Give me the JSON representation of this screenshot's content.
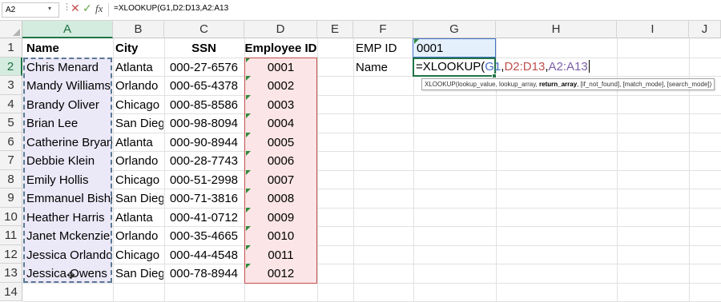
{
  "formula_bar": {
    "name_box": "A2",
    "dots": "⋮",
    "cancel_icon": "✕",
    "enter_icon": "✓",
    "fx_label": "fx",
    "formula": "=XLOOKUP(G1,D2:D13,A2:A13"
  },
  "columns": [
    "A",
    "B",
    "C",
    "D",
    "E",
    "F",
    "G",
    "H",
    "I",
    "J"
  ],
  "rows": [
    "1",
    "2",
    "3",
    "4",
    "5",
    "6",
    "7",
    "8",
    "9",
    "10",
    "11",
    "12",
    "13",
    "14"
  ],
  "table": {
    "headers": [
      "Name",
      "City",
      "SSN",
      "Employee ID"
    ],
    "data": [
      [
        "Chris Menard",
        "Atlanta",
        "000-27-6576",
        "0001"
      ],
      [
        "Mandy Williams",
        "Orlando",
        "000-65-4378",
        "0002"
      ],
      [
        "Brandy Oliver",
        "Chicago",
        "000-85-8586",
        "0003"
      ],
      [
        "Brian Lee",
        "San Diego",
        "000-98-8094",
        "0004"
      ],
      [
        "Catherine Bryan",
        "Atlanta",
        "000-90-8944",
        "0005"
      ],
      [
        "Debbie Klein",
        "Orlando",
        "000-28-7743",
        "0006"
      ],
      [
        "Emily Hollis",
        "Chicago",
        "000-51-2998",
        "0007"
      ],
      [
        "Emmanuel Bishop",
        "San Diego",
        "000-71-3816",
        "0008"
      ],
      [
        "Heather Harris",
        "Atlanta",
        "000-41-0712",
        "0009"
      ],
      [
        "Janet Mckenzie",
        "Orlando",
        "000-35-4665",
        "0010"
      ],
      [
        "Jessica Orlando",
        "Chicago",
        "000-44-4548",
        "0011"
      ],
      [
        "Jessica Owens",
        "San Diego",
        "000-78-8944",
        "0012"
      ]
    ]
  },
  "lookup": {
    "emp_id_label": "EMP ID",
    "emp_id_value": "0001",
    "name_label": "Name",
    "edit_prefix": "=XLOOKUP(",
    "edit_arg1": "G1",
    "edit_comma1": ",",
    "edit_arg2": "D2:D13",
    "edit_comma2": ",",
    "edit_arg3": "A2:A13"
  },
  "tooltip": {
    "prefix": "XLOOKUP(lookup_value, lookup_array, ",
    "bold": "return_array",
    "suffix": ", [if_not_found], [match_mode], [search_mode])"
  },
  "colors": {
    "ref_g1": "#4472c4",
    "ref_d": "#c0504d",
    "ref_a": "#7b5ea7",
    "excel_green": "#217346"
  }
}
